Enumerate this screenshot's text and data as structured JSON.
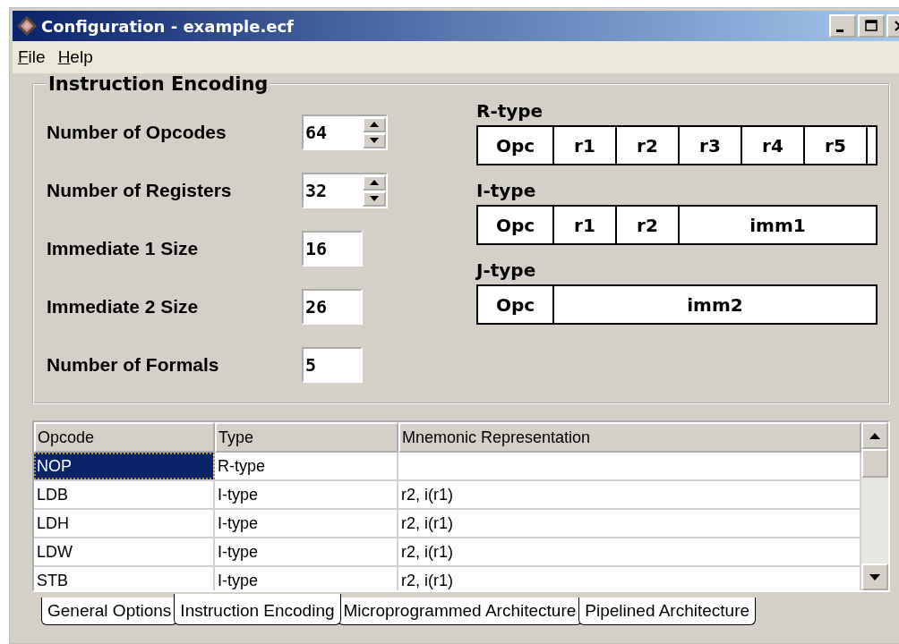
{
  "window": {
    "title": "Configuration - example.ecf"
  },
  "menu": [
    {
      "label": "File"
    },
    {
      "label": "Help"
    }
  ],
  "group": {
    "title": "Instruction Encoding",
    "fields": [
      {
        "label": "Number of Opcodes",
        "value": "64",
        "kind": "spinner"
      },
      {
        "label": "Number of Registers",
        "value": "32",
        "kind": "spinner"
      },
      {
        "label": "Immediate 1 Size",
        "value": "16",
        "kind": "text"
      },
      {
        "label": "Immediate 2 Size",
        "value": "26",
        "kind": "text"
      },
      {
        "label": "Number of Formals",
        "value": "5",
        "kind": "text"
      }
    ],
    "formats": [
      {
        "name": "R-type",
        "fields": [
          {
            "kind": "opcode",
            "label": "Opc"
          },
          {
            "kind": "register",
            "label": "r1"
          },
          {
            "kind": "register",
            "label": "r2"
          },
          {
            "kind": "register",
            "label": "r3"
          },
          {
            "kind": "register",
            "label": "r4"
          },
          {
            "kind": "register",
            "label": "r5"
          },
          {
            "kind": "spacer"
          }
        ]
      },
      {
        "name": "I-type",
        "fields": [
          {
            "kind": "opcode",
            "label": "Opc"
          },
          {
            "kind": "register",
            "label": "r1"
          },
          {
            "kind": "register",
            "label": "r2"
          },
          {
            "kind": "immediate",
            "label": "imm1"
          }
        ]
      },
      {
        "name": "J-type",
        "fields": [
          {
            "kind": "opcode",
            "label": "Opc"
          },
          {
            "kind": "immediate",
            "label": "imm2"
          }
        ]
      }
    ]
  },
  "table": {
    "columns": [
      "Opcode",
      "Type",
      "Mnemonic Representation"
    ],
    "rows": [
      {
        "cells": [
          "NOP",
          "R-type"
        ],
        "selected": true
      },
      {
        "cells": [
          "LDB",
          "I-type",
          "r2, i(r1)"
        ],
        "selected": false
      },
      {
        "cells": [
          "LDH",
          "I-type",
          "r2, i(r1)"
        ],
        "selected": false
      },
      {
        "cells": [
          "LDW",
          "I-type",
          "r2, i(r1)"
        ],
        "selected": false
      },
      {
        "cells": [
          "STB",
          "I-type",
          "r2, i(r1)"
        ],
        "selected": false
      }
    ]
  },
  "tabs": [
    {
      "label": "General Options",
      "selected": false
    },
    {
      "label": "Instruction Encoding",
      "selected": true
    },
    {
      "label": "Microprogrammed Architecture",
      "selected": false
    },
    {
      "label": "Pipelined Architecture",
      "selected": false
    }
  ]
}
